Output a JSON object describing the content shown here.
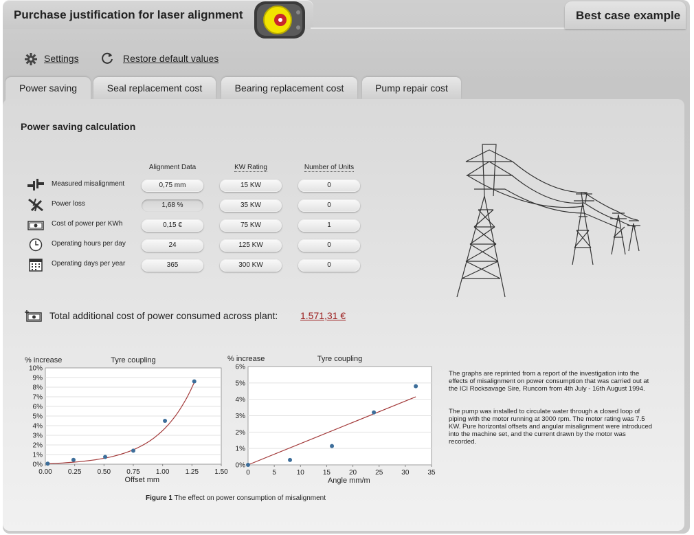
{
  "header": {
    "title": "Purchase justification for laser alignment",
    "example_tab": "Best case example"
  },
  "toolbar": {
    "settings_label": "Settings",
    "restore_label": "Restore default values"
  },
  "tabs": [
    {
      "label": "Power saving",
      "active": true
    },
    {
      "label": "Seal replacement cost",
      "active": false
    },
    {
      "label": "Bearing replacement cost",
      "active": false
    },
    {
      "label": "Pump repair cost",
      "active": false
    }
  ],
  "calc": {
    "title": "Power saving calculation",
    "columns": {
      "alignment": "Alignment Data",
      "kw": "KW Rating",
      "units": "Number of Units"
    },
    "rows": [
      {
        "label": "Measured misalignment",
        "icon": "misalignment-icon",
        "value": "0,75 mm",
        "kw": "15 KW",
        "units": "0"
      },
      {
        "label": "Power loss",
        "icon": "power-loss-icon",
        "value": "1,68 %",
        "kw": "35 KW",
        "units": "0"
      },
      {
        "label": "Cost of power per KWh",
        "icon": "money-icon",
        "value": "0,15 €",
        "kw": "75 KW",
        "units": "1"
      },
      {
        "label": "Operating hours per day",
        "icon": "clock-icon",
        "value": "24",
        "kw": "125 KW",
        "units": "0"
      },
      {
        "label": "Operating days per year",
        "icon": "calendar-icon",
        "value": "365",
        "kw": "300 KW",
        "units": "0"
      }
    ],
    "total_label": "Total additional cost of power consumed across plant:",
    "total_value": "1.571,31 €"
  },
  "chart_data": [
    {
      "type": "scatter",
      "title": "Tyre coupling",
      "ylabel": "% increase",
      "xlabel": "Offset mm",
      "x_ticks": [
        "0.00",
        "0.25",
        "0.50",
        "0.75",
        "1.00",
        "1.25",
        "1.50"
      ],
      "y_ticks": [
        "0%",
        "1%",
        "2%",
        "3%",
        "4%",
        "5%",
        "6%",
        "7%",
        "8%",
        "9%",
        "10%"
      ],
      "xlim": [
        0,
        1.5
      ],
      "ylim": [
        0,
        10
      ],
      "points": [
        [
          0.02,
          0.05
        ],
        [
          0.24,
          0.45
        ],
        [
          0.51,
          0.75
        ],
        [
          0.75,
          1.4
        ],
        [
          1.02,
          4.5
        ],
        [
          1.27,
          8.6
        ]
      ],
      "fit": "exponential",
      "point_color": "#3d6e9a",
      "line_color": "#a33a3a"
    },
    {
      "type": "scatter",
      "title": "Tyre coupling",
      "ylabel": "% increase",
      "xlabel": "Angle mm/m",
      "x_ticks": [
        "0",
        "5",
        "10",
        "15",
        "20",
        "25",
        "30",
        "35"
      ],
      "y_ticks": [
        "0%",
        "1%",
        "2%",
        "3%",
        "4%",
        "5%",
        "6%"
      ],
      "xlim": [
        0,
        35
      ],
      "ylim": [
        0,
        6
      ],
      "points": [
        [
          8,
          0.3
        ],
        [
          16,
          1.15
        ],
        [
          24,
          3.2
        ],
        [
          32,
          4.8
        ]
      ],
      "fit": "linear",
      "fit_line": [
        [
          0,
          0
        ],
        [
          32,
          4.15
        ]
      ],
      "point_color": "#3d6e9a",
      "line_color": "#a33a3a"
    }
  ],
  "figure": {
    "caption_bold": "Figure 1",
    "caption_text": " The effect on power consumption of misalignment"
  },
  "description": [
    "The graphs are reprinted from a report of the investigation into the effects of misalignment on power consumption that was carried out at the ICI Rocksavage Sire, Runcorn from 4th July - 16th August 1994.",
    "The pump was installed to circulate water through a closed loop of piping with the motor running at 3000 rpm. The motor rating was 7.5 KW. Pure horizontal offsets and angular misalignment were introduced into the machine set, and the current drawn by the motor was recorded."
  ]
}
